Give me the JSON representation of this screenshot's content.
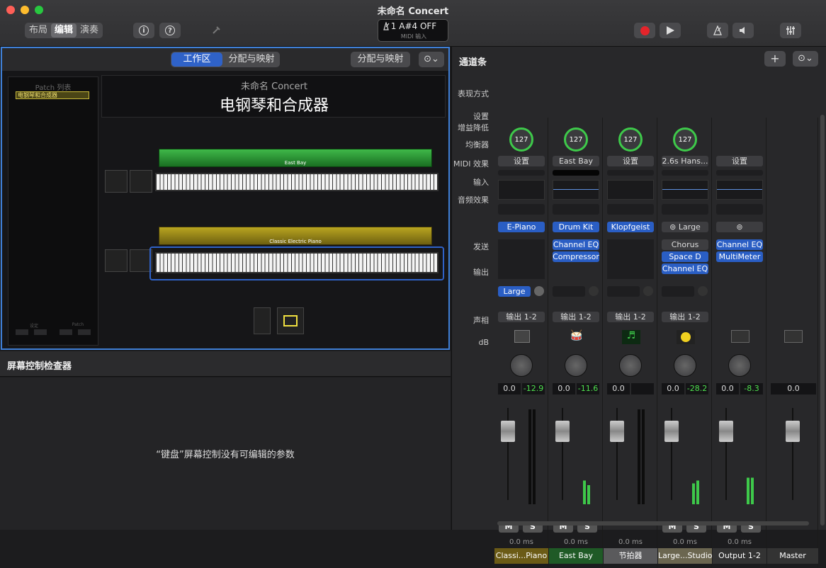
{
  "window": {
    "title": "未命名 Concert"
  },
  "toolbar": {
    "segments": [
      "布局",
      "编辑",
      "演奏"
    ],
    "selected_segment": "编辑",
    "info_icon": "i",
    "help_icon": "?",
    "lcd_top": "1   A#4   OFF",
    "lcd_sub": "MIDI 输入"
  },
  "workspace": {
    "tab_workspace": "工作区",
    "tab_mapping": "分配与映射",
    "mapping_button": "分配与映射",
    "patch_list_title": "Patch 列表",
    "patch_item": "电钢琴和合成器",
    "bottom_left_label": "设定",
    "bottom_right_label": "Patch",
    "concert_name": "未命名 Concert",
    "patch_title": "电钢琴和合成器",
    "keyboard1_label": "East Bay",
    "keyboard2_label": "Classic Electric Piano"
  },
  "inspector": {
    "title": "屏幕控制检查器",
    "message": "“键盘”屏幕控制没有可编辑的参数"
  },
  "mixer": {
    "title": "通道条",
    "row_labels": {
      "display": "表现方式",
      "setting": "设置",
      "gain": "增益降低",
      "eq": "均衡器",
      "midi_fx": "MIDI 效果",
      "input": "输入",
      "audio_fx": "音频效果",
      "sends": "发送",
      "output": "输出",
      "pan": "声相",
      "db": "dB"
    },
    "scale": [
      "6",
      "3",
      "0",
      "3",
      "6",
      "10",
      "15",
      "20",
      "30",
      "40",
      "∞"
    ],
    "meter_scale": [
      "0",
      "3",
      "6",
      "9",
      "12",
      "15",
      "18",
      "21",
      "24",
      "30",
      "35",
      "40",
      "45",
      "50",
      "60"
    ],
    "strips": [
      {
        "knob": "127",
        "setting": "设置",
        "input": "E-Piano",
        "fx": [],
        "send": "Large",
        "output": "输出 1-2",
        "vol": "0.0",
        "peak": "-12.9",
        "ms": "0.0 ms",
        "name": "Classi...Piano",
        "color": "#6b5b16"
      },
      {
        "knob": "127",
        "setting": "East Bay",
        "input": "Drum Kit",
        "fx": [
          "Channel EQ",
          "Compressor"
        ],
        "send": "",
        "output": "输出 1-2",
        "vol": "0.0",
        "peak": "-11.6",
        "ms": "0.0 ms",
        "name": "East Bay",
        "color": "#1f5a26"
      },
      {
        "knob": "127",
        "setting": "设置",
        "input": "Klopfgeist",
        "fx": [],
        "send": "",
        "output": "输出 1-2",
        "vol": "0.0",
        "peak": "",
        "ms": "0.0 ms",
        "name": "节拍器",
        "color": "#5a5a5c"
      },
      {
        "knob": "127",
        "setting": "2.6s Hans...",
        "input": "Large",
        "fx": [
          "Chorus",
          "Space D",
          "Channel EQ"
        ],
        "send": "",
        "output": "输出 1-2",
        "vol": "0.0",
        "peak": "-28.2",
        "ms": "0.0 ms",
        "name": "Large...Studio",
        "color": "#6b6650"
      },
      {
        "knob": "",
        "setting": "设置",
        "input": "",
        "fx": [
          "Channel EQ",
          "MultiMeter"
        ],
        "send": "",
        "output": "",
        "vol": "0.0",
        "peak": "-8.3",
        "ms": "0.0 ms",
        "name": "Output 1-2",
        "color": "#333"
      },
      {
        "knob": "",
        "setting": "",
        "input": "",
        "fx": [],
        "send": "",
        "output": "",
        "vol": "0.0",
        "peak": "",
        "ms": "",
        "name": "Master",
        "color": "#333"
      }
    ],
    "mute": "M",
    "solo": "S"
  }
}
